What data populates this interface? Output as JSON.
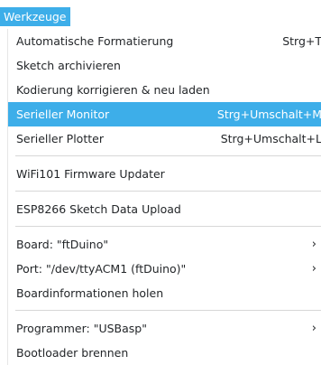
{
  "menu_title": "Werkzeuge",
  "groups": [
    [
      {
        "label": "Automatische Formatierung",
        "shortcut": "Strg+T"
      },
      {
        "label": "Sketch archivieren"
      },
      {
        "label": "Kodierung korrigieren & neu laden"
      },
      {
        "label": "Serieller Monitor",
        "shortcut": "Strg+Umschalt+M",
        "active": true
      },
      {
        "label": "Serieller Plotter",
        "shortcut": "Strg+Umschalt+L"
      }
    ],
    [
      {
        "label": "WiFi101 Firmware Updater"
      }
    ],
    [
      {
        "label": "ESP8266 Sketch Data Upload"
      }
    ],
    [
      {
        "label": "Board: \"ftDuino\"",
        "submenu": true
      },
      {
        "label": "Port: \"/dev/ttyACM1 (ftDuino)\"",
        "submenu": true
      },
      {
        "label": "Boardinformationen holen"
      }
    ],
    [
      {
        "label": "Programmer: \"USBasp\"",
        "submenu": true
      },
      {
        "label": "Bootloader brennen"
      }
    ]
  ],
  "submenu_glyph": "›",
  "colors": {
    "highlight": "#3daee9",
    "text": "#232629",
    "separator": "#d7d7d7"
  }
}
